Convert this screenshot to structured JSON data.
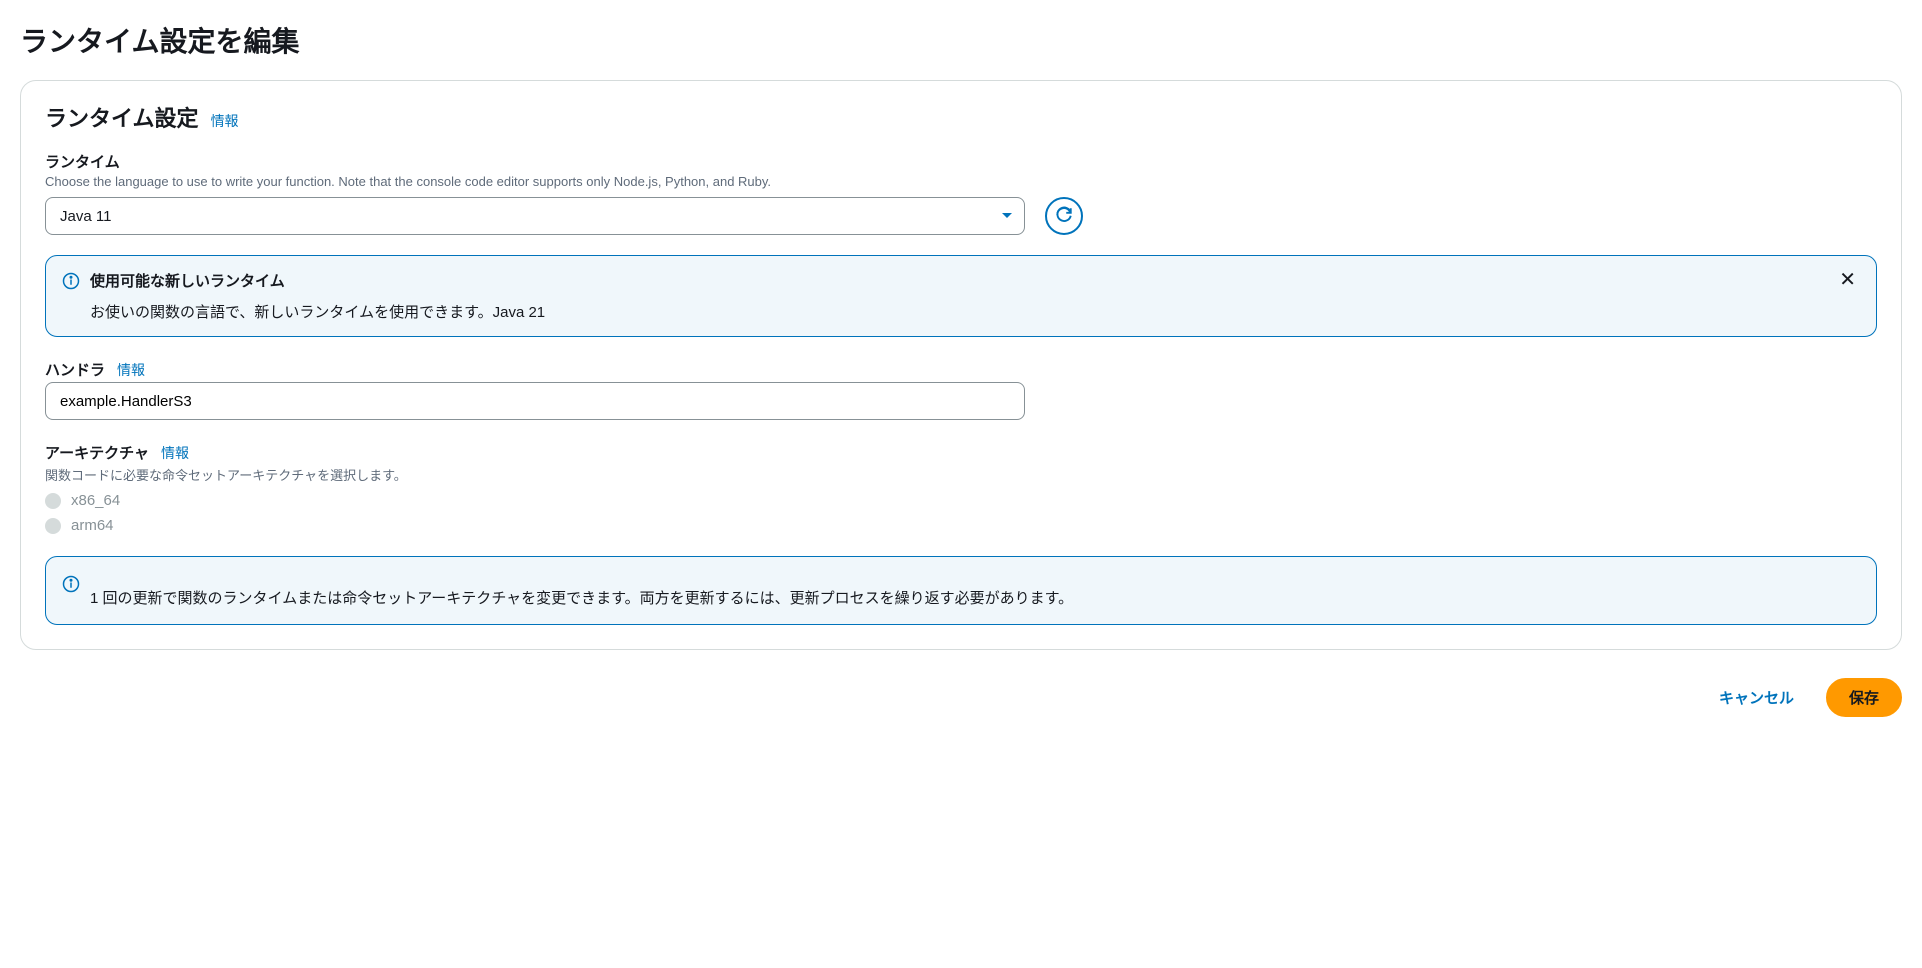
{
  "page": {
    "title": "ランタイム設定を編集"
  },
  "section": {
    "title": "ランタイム設定",
    "infoLink": "情報"
  },
  "runtime": {
    "label": "ランタイム",
    "description": "Choose the language to use to write your function. Note that the console code editor supports only Node.js, Python, and Ruby.",
    "selected": "Java 11"
  },
  "newRuntimeAlert": {
    "title": "使用可能な新しいランタイム",
    "text": "お使いの関数の言語で、新しいランタイムを使用できます。Java 21"
  },
  "handler": {
    "label": "ハンドラ",
    "infoLink": "情報",
    "value": "example.HandlerS3"
  },
  "architecture": {
    "label": "アーキテクチャ",
    "infoLink": "情報",
    "description": "関数コードに必要な命令セットアーキテクチャを選択します。",
    "options": [
      "x86_64",
      "arm64"
    ]
  },
  "updateInfoAlert": {
    "text": "1 回の更新で関数のランタイムまたは命令セットアーキテクチャを変更できます。両方を更新するには、更新プロセスを繰り返す必要があります。"
  },
  "buttons": {
    "cancel": "キャンセル",
    "save": "保存"
  }
}
